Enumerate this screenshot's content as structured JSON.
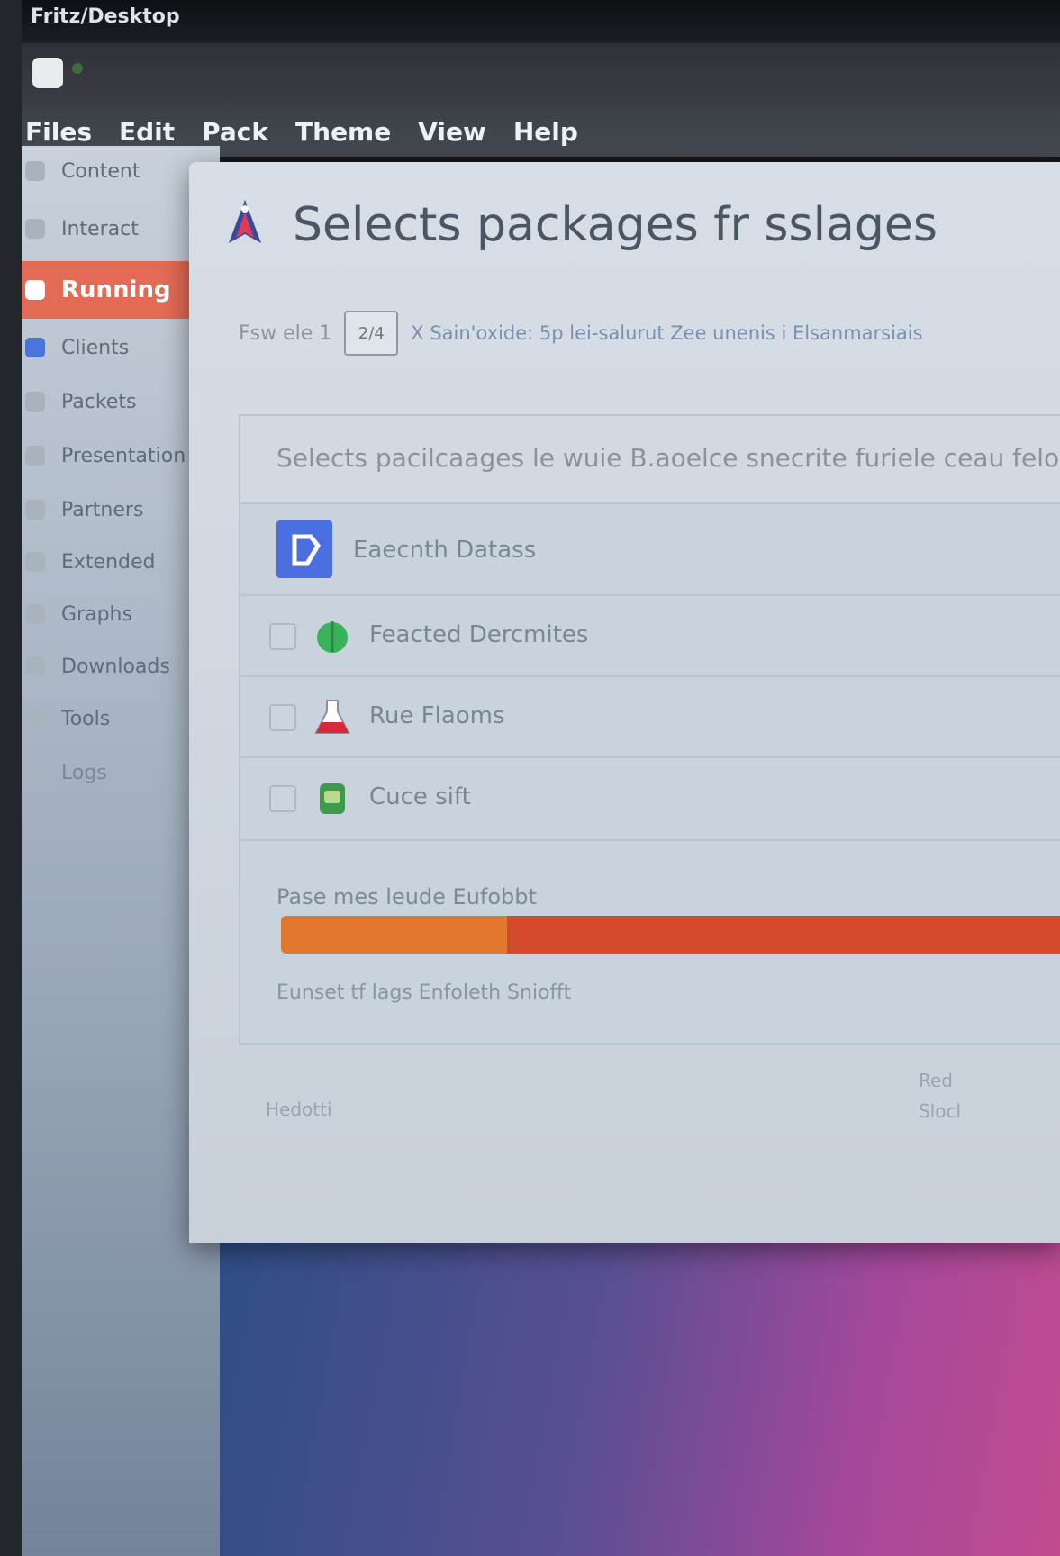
{
  "window": {
    "title": "Fritz/Desktop"
  },
  "menubar": {
    "items": [
      "Files",
      "Edit",
      "Pack",
      "Theme",
      "View",
      "Help"
    ]
  },
  "sidebar": {
    "items": [
      {
        "label": "Content",
        "active": false
      },
      {
        "label": "Interact",
        "active": false
      },
      {
        "label": "Running",
        "active": true
      },
      {
        "label": "Clients",
        "active": false
      },
      {
        "label": "Packets",
        "active": false
      },
      {
        "label": "Presentation",
        "active": false
      },
      {
        "label": "Partners",
        "active": false
      },
      {
        "label": "Extended",
        "active": false
      },
      {
        "label": "Graphs",
        "active": false
      },
      {
        "label": "Downloads",
        "active": false
      },
      {
        "label": "Tools",
        "active": false
      },
      {
        "label": "Logs",
        "active": false
      }
    ]
  },
  "dialog": {
    "title": "Selects packages fr sslages",
    "step_label": "Fsw ele 1",
    "step_value": "2/4",
    "step_links": "X Sain'oxide: 5p lei-salurut  Zee unenis i Elsanmarsiais",
    "panel_header": "Selects pacilcaages le wuie B.aoelce snecrite furiele ceau felo",
    "packages": [
      {
        "name": "Eaecnth Datass",
        "checked": true
      },
      {
        "name": "Feacted Dercmites",
        "checked": false
      },
      {
        "name": "Rue Flaoms",
        "checked": false
      },
      {
        "name": "Cuce sift",
        "checked": false
      }
    ],
    "progress_label": "Pase mes leude Eufobbt",
    "progress": {
      "fraction_first": 0.29
    },
    "progress_sub": "Eunset tf lags Enfoleth Sniofft",
    "footer_left": "Hedotti",
    "footer_right": [
      "Red",
      "Slocl"
    ]
  },
  "colors": {
    "active_nav": "#e36a55",
    "progress_orange": "#e27830",
    "progress_red": "#d34a2d",
    "package_blue": "#4b6fe0"
  }
}
